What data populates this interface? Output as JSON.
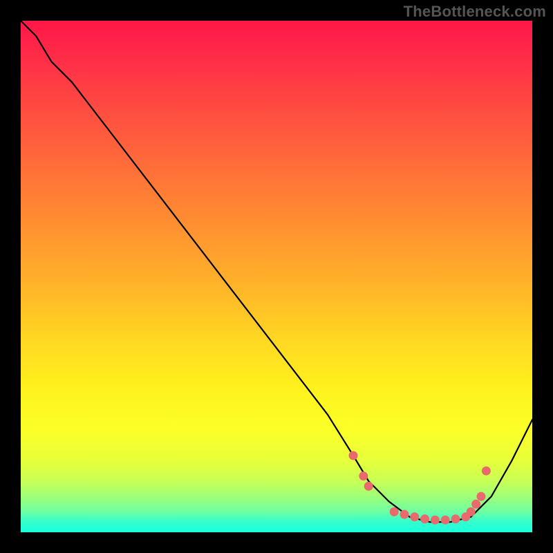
{
  "watermark": "TheBottleneck.com",
  "chart_data": {
    "type": "line",
    "title": "",
    "xlabel": "",
    "ylabel": "",
    "xlim": [
      0,
      100
    ],
    "ylim": [
      0,
      100
    ],
    "grid": false,
    "legend": false,
    "series": [
      {
        "name": "bottleneck-curve",
        "x": [
          0,
          3,
          6,
          10,
          20,
          30,
          40,
          50,
          60,
          65,
          68,
          72,
          76,
          80,
          84,
          88,
          92,
          96,
          100
        ],
        "y": [
          100,
          97,
          92,
          88,
          75,
          62,
          49,
          36,
          23,
          15,
          10,
          6,
          3,
          2,
          2,
          3,
          7,
          14,
          22
        ]
      }
    ],
    "markers": [
      {
        "x": 65,
        "y": 15
      },
      {
        "x": 67,
        "y": 11
      },
      {
        "x": 68,
        "y": 9
      },
      {
        "x": 73,
        "y": 4
      },
      {
        "x": 75,
        "y": 3.5
      },
      {
        "x": 77,
        "y": 3
      },
      {
        "x": 79,
        "y": 2.6
      },
      {
        "x": 81,
        "y": 2.4
      },
      {
        "x": 83,
        "y": 2.4
      },
      {
        "x": 85,
        "y": 2.6
      },
      {
        "x": 87,
        "y": 3
      },
      {
        "x": 88,
        "y": 4
      },
      {
        "x": 89,
        "y": 5.5
      },
      {
        "x": 90,
        "y": 7
      },
      {
        "x": 91,
        "y": 12
      }
    ],
    "marker_color": "#e96a6d",
    "line_color": "#000000",
    "background_gradient": [
      "#ff1748",
      "#ff5a3e",
      "#ffae2a",
      "#fff21d",
      "#c8ff55",
      "#34ffcd"
    ]
  }
}
